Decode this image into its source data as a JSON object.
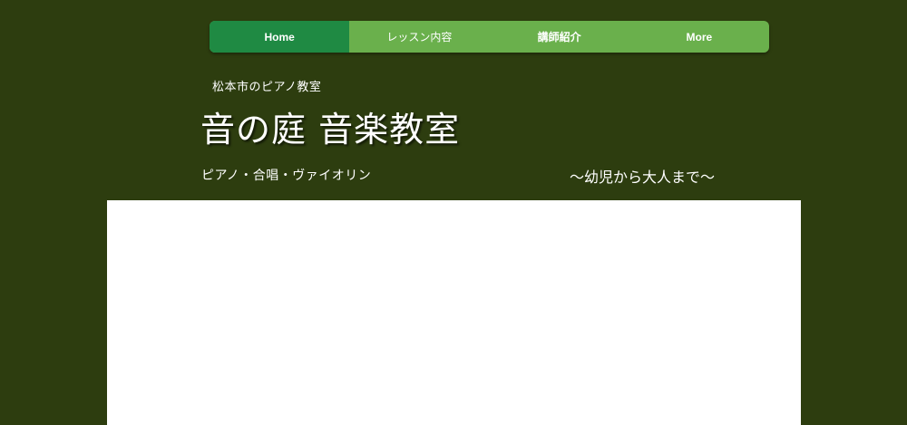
{
  "nav": {
    "items": [
      {
        "label": "Home"
      },
      {
        "label": "レッスン内容"
      },
      {
        "label": "講師紹介"
      },
      {
        "label": "More"
      }
    ]
  },
  "header": {
    "subtitle": "松本市のピアノ教室",
    "title": "音の庭 音楽教室",
    "tagline_left": "ピアノ・合唱・ヴァイオリン",
    "tagline_right": "～幼児から大人まで～"
  },
  "colors": {
    "background": "#2d3d0f",
    "nav_background": "#6ab04c",
    "nav_active": "#1f8a43",
    "panel": "#ffffff"
  }
}
